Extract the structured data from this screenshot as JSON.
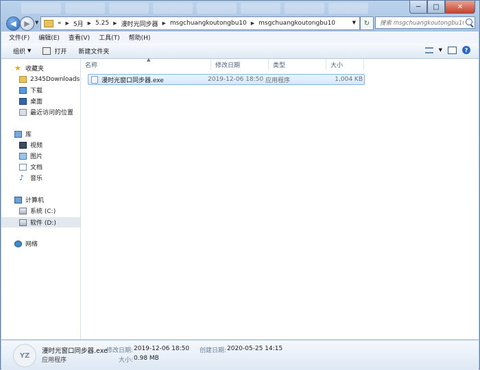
{
  "window": {
    "min": "─",
    "max": "□",
    "close": "✕"
  },
  "address": {
    "breadcrumb": [
      "«",
      "5月",
      "5.25",
      "漫时光同步器",
      "msgchuangkoutongbu10",
      "msgchuangkoutongbu10"
    ],
    "search_placeholder": "搜索 msgchuangkoutongbu10"
  },
  "menu": [
    "文件(F)",
    "编辑(E)",
    "查看(V)",
    "工具(T)",
    "帮助(H)"
  ],
  "toolbar": {
    "organize": "组织",
    "open": "打开",
    "new_folder": "新建文件夹",
    "help": "?"
  },
  "navigation": {
    "favorites": {
      "label": "收藏夹",
      "items": [
        "2345Downloads",
        "下载",
        "桌面",
        "最近访问的位置"
      ]
    },
    "libraries": {
      "label": "库",
      "items": [
        "视频",
        "图片",
        "文档",
        "音乐"
      ]
    },
    "computer": {
      "label": "计算机",
      "items": [
        "系统 (C:)",
        "软件 (D:)"
      ]
    },
    "network": {
      "label": "网络"
    },
    "selected": "软件 (D:)"
  },
  "columns": [
    "名称",
    "修改日期",
    "类型",
    "大小"
  ],
  "files": [
    {
      "name": "漫时光窗口同步器.exe",
      "modified": "2019-12-06 18:50",
      "type": "应用程序",
      "size": "1,004 KB"
    }
  ],
  "details": {
    "thumb": "YZ",
    "name": "漫时光窗口同步器.exe",
    "type": "应用程序",
    "modified_label": "修改日期:",
    "modified": "2019-12-06 18:50",
    "created_label": "创建日期:",
    "created": "2020-05-25 14:15",
    "size_label": "大小:",
    "size": "0.98 MB"
  }
}
